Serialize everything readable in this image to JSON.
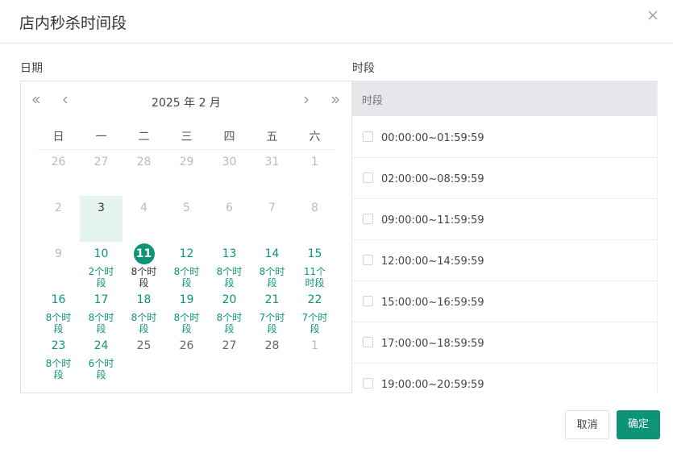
{
  "dialog": {
    "title": "店内秒杀时间段",
    "cancel_label": "取消",
    "confirm_label": "确定"
  },
  "labels": {
    "date": "日期",
    "slot": "时段"
  },
  "calendar": {
    "month_title": "2025 年 2 月",
    "weekdays": [
      "日",
      "一",
      "二",
      "三",
      "四",
      "五",
      "六"
    ],
    "weeks": [
      [
        {
          "num": "26",
          "state": "other"
        },
        {
          "num": "27",
          "state": "other"
        },
        {
          "num": "28",
          "state": "other"
        },
        {
          "num": "29",
          "state": "other"
        },
        {
          "num": "30",
          "state": "other"
        },
        {
          "num": "31",
          "state": "other"
        },
        {
          "num": "1",
          "state": "disabled"
        }
      ],
      [
        {
          "num": "2",
          "state": "disabled"
        },
        {
          "num": "3",
          "state": "today"
        },
        {
          "num": "4",
          "state": "disabled"
        },
        {
          "num": "5",
          "state": "disabled"
        },
        {
          "num": "6",
          "state": "disabled"
        },
        {
          "num": "7",
          "state": "disabled"
        },
        {
          "num": "8",
          "state": "disabled"
        }
      ],
      [
        {
          "num": "9",
          "state": "disabled"
        },
        {
          "num": "10",
          "state": "avail",
          "count": "2个时段"
        },
        {
          "num": "11",
          "state": "selected",
          "count": "8个时段"
        },
        {
          "num": "12",
          "state": "avail",
          "count": "8个时段"
        },
        {
          "num": "13",
          "state": "avail",
          "count": "8个时段"
        },
        {
          "num": "14",
          "state": "avail",
          "count": "8个时段"
        },
        {
          "num": "15",
          "state": "avail",
          "count": "11个时段"
        }
      ],
      [
        {
          "num": "16",
          "state": "avail",
          "count": "8个时段"
        },
        {
          "num": "17",
          "state": "avail",
          "count": "8个时段"
        },
        {
          "num": "18",
          "state": "avail",
          "count": "8个时段"
        },
        {
          "num": "19",
          "state": "avail",
          "count": "8个时段"
        },
        {
          "num": "20",
          "state": "avail",
          "count": "8个时段"
        },
        {
          "num": "21",
          "state": "avail",
          "count": "7个时段"
        },
        {
          "num": "22",
          "state": "avail",
          "count": "7个时段"
        }
      ],
      [
        {
          "num": "23",
          "state": "avail",
          "count": "8个时段"
        },
        {
          "num": "24",
          "state": "avail",
          "count": "6个时段"
        },
        {
          "num": "25",
          "state": "plain"
        },
        {
          "num": "26",
          "state": "plain"
        },
        {
          "num": "27",
          "state": "plain"
        },
        {
          "num": "28",
          "state": "plain"
        },
        {
          "num": "1",
          "state": "other"
        }
      ]
    ]
  },
  "slots": {
    "header": "时段",
    "items": [
      "00:00:00~01:59:59",
      "02:00:00~08:59:59",
      "09:00:00~11:59:59",
      "12:00:00~14:59:59",
      "15:00:00~16:59:59",
      "17:00:00~18:59:59",
      "19:00:00~20:59:59"
    ]
  },
  "colors": {
    "accent": "#0d9477",
    "today_bg": "#e6f4f1"
  }
}
